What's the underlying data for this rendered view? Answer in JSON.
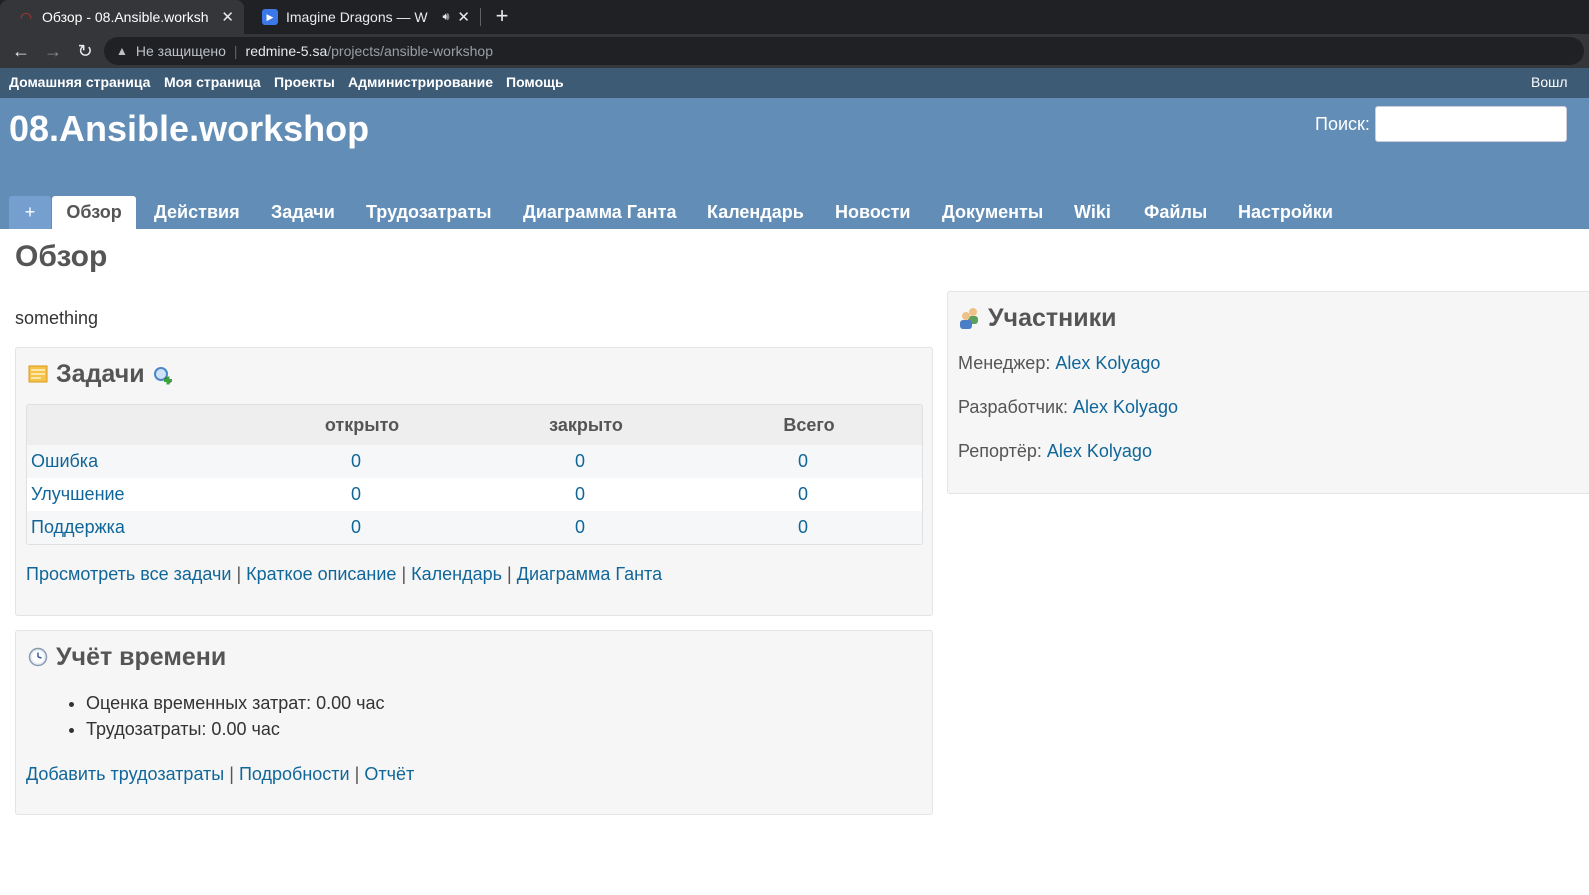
{
  "browser": {
    "tabs": [
      {
        "title": "Обзор - 08.Ansible.worksh",
        "favicon": "redmine-icon",
        "active": true
      },
      {
        "title": "Imagine Dragons — W",
        "favicon": "youtube-music-icon",
        "audio": true,
        "active": false
      }
    ],
    "security_text": "Не защищено",
    "url_host": "redmine-5.sa",
    "url_path": "/projects/ansible-workshop"
  },
  "topmenu": {
    "items": [
      "Домашняя страница",
      "Моя страница",
      "Проекты",
      "Администрирование",
      "Помощь"
    ],
    "account": "Вошл"
  },
  "header": {
    "project_title": "08.Ansible.workshop",
    "search_label": "Поиск:",
    "search_value": ""
  },
  "tabs": {
    "plus": "+",
    "items": [
      "Обзор",
      "Действия",
      "Задачи",
      "Трудозатраты",
      "Диаграмма Ганта",
      "Календарь",
      "Новости",
      "Документы",
      "Wiki",
      "Файлы",
      "Настройки"
    ],
    "selected": "Обзор"
  },
  "page": {
    "title": "Обзор",
    "description": "something"
  },
  "issues": {
    "title": "Задачи",
    "columns": [
      "",
      "открыто",
      "закрыто",
      "Всего"
    ],
    "rows": [
      {
        "tracker": "Ошибка",
        "open": "0",
        "closed": "0",
        "total": "0"
      },
      {
        "tracker": "Улучшение",
        "open": "0",
        "closed": "0",
        "total": "0"
      },
      {
        "tracker": "Поддержка",
        "open": "0",
        "closed": "0",
        "total": "0"
      }
    ],
    "links": [
      "Просмотреть все задачи",
      "Краткое описание",
      "Календарь",
      "Диаграмма Ганта"
    ],
    "separator": "|"
  },
  "time_tracking": {
    "title": "Учёт времени",
    "items": [
      "Оценка временных затрат: 0.00 час",
      "Трудозатраты: 0.00 час"
    ],
    "links": [
      "Добавить трудозатраты",
      "Подробности",
      "Отчёт"
    ]
  },
  "members": {
    "title": "Участники",
    "rows": [
      {
        "role": "Менеджер:",
        "name": "Alex Kolyago"
      },
      {
        "role": "Разработчик:",
        "name": "Alex Kolyago"
      },
      {
        "role": "Репортёр:",
        "name": "Alex Kolyago"
      }
    ]
  },
  "colors": {
    "top_menu": "#3e5b76",
    "header": "#628db6",
    "link": "#116699"
  }
}
